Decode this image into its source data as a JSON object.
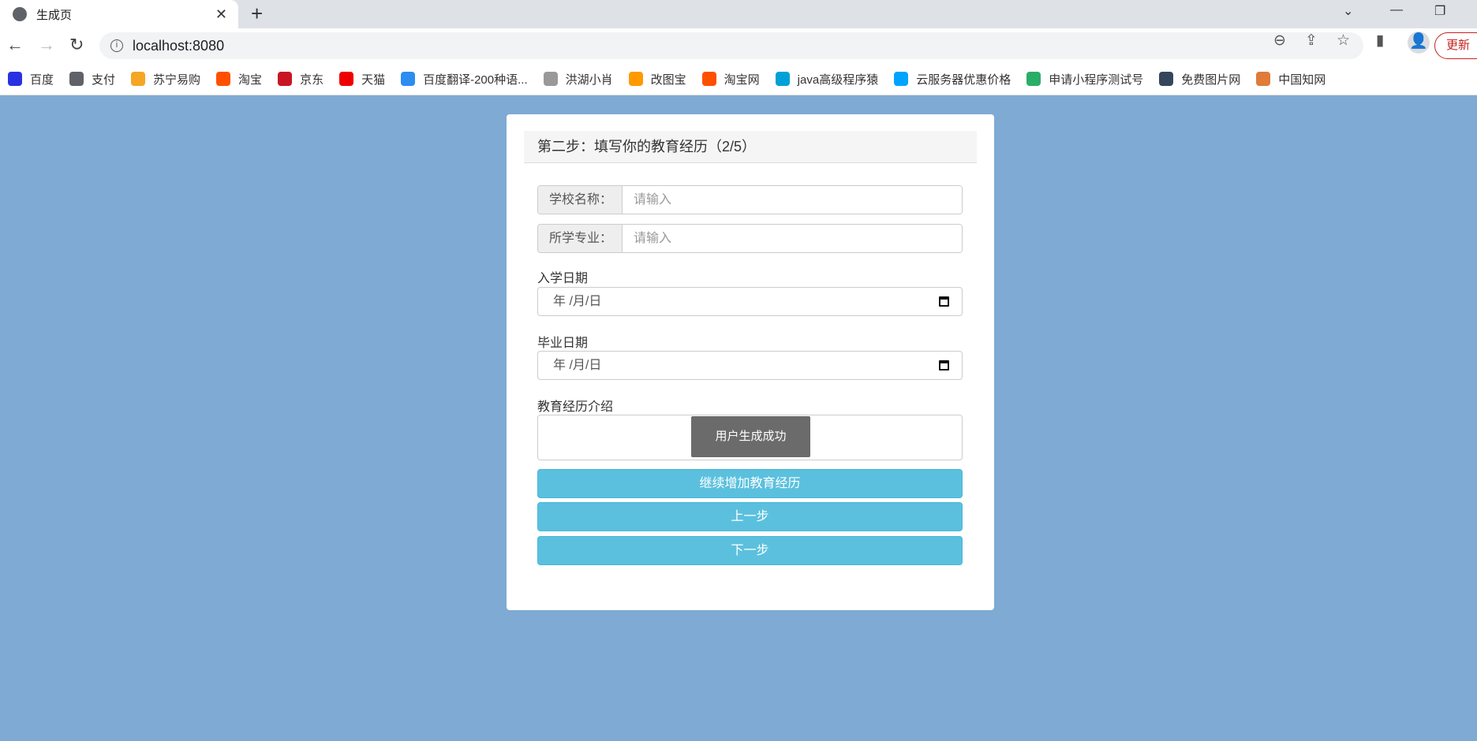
{
  "browser": {
    "tab_title": "生成页",
    "url": "localhost:8080",
    "update_label": "更新",
    "bookmarks": [
      {
        "label": "百度",
        "color": "#2932e1"
      },
      {
        "label": "支付",
        "color": "#5f6368"
      },
      {
        "label": "苏宁易购",
        "color": "#f5a623"
      },
      {
        "label": "淘宝",
        "color": "#ff5000"
      },
      {
        "label": "京东",
        "color": "#c91623"
      },
      {
        "label": "天猫",
        "color": "#e00"
      },
      {
        "label": "百度翻译-200种语...",
        "color": "#2d8cf0"
      },
      {
        "label": "洪湖小肖",
        "color": "#999"
      },
      {
        "label": "改图宝",
        "color": "#ff9900"
      },
      {
        "label": "淘宝网",
        "color": "#ff5000"
      },
      {
        "label": "java高级程序猿",
        "color": "#00a1d6"
      },
      {
        "label": "云服务器优惠价格",
        "color": "#00a3ff"
      },
      {
        "label": "申请小程序测试号",
        "color": "#2aae67"
      },
      {
        "label": "免费图片网",
        "color": "#35465c"
      },
      {
        "label": "中国知网",
        "color": "#e07b39"
      }
    ]
  },
  "form": {
    "title": "第二步：填写你的教育经历（2/5）",
    "school_label": "学校名称：",
    "school_placeholder": "请输入",
    "major_label": "所学专业：",
    "major_placeholder": "请输入",
    "start_date_label": "入学日期",
    "start_date_value": "年 /月/日",
    "end_date_label": "毕业日期",
    "end_date_value": "年 /月/日",
    "intro_label": "教育经历介绍",
    "toast": "用户生成成功",
    "add_button": "继续增加教育经历",
    "prev_button": "上一步",
    "next_button": "下一步"
  }
}
